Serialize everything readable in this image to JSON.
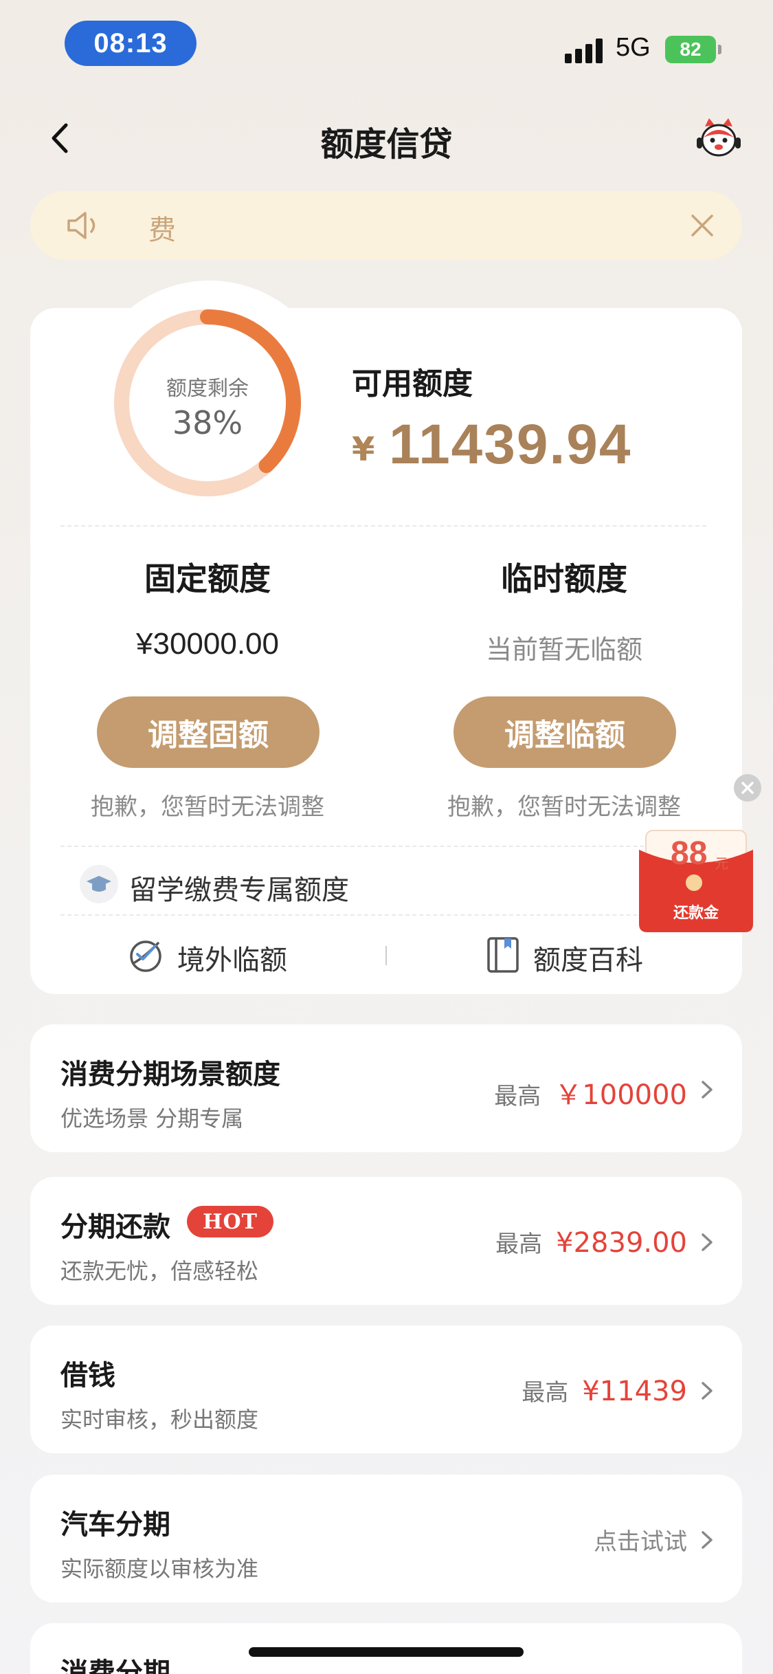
{
  "status_bar": {
    "time": "08:13",
    "network": "5G",
    "battery": "82"
  },
  "nav": {
    "title": "额度信贷"
  },
  "notice": {
    "text": "费"
  },
  "credit": {
    "ring_label": "额度剩余",
    "ring_percent": "38%",
    "ring_fraction": 0.38,
    "available_label": "可用额度",
    "currency": "¥",
    "available_amount": "11439.94"
  },
  "fixed": {
    "title": "固定额度",
    "amount": "¥30000.00",
    "button": "调整固额",
    "note": "抱歉，您暂时无法调整"
  },
  "temporary": {
    "title": "临时额度",
    "status": "当前暂无临额",
    "button": "调整临额",
    "note": "抱歉，您暂时无法调整"
  },
  "study": {
    "label": "留学缴费专属额度"
  },
  "quick_links": [
    {
      "label": "境外临额",
      "icon": "overseas-icon"
    },
    {
      "label": "额度百科",
      "icon": "book-icon"
    }
  ],
  "float_reward": {
    "amount": "88",
    "unit": "元",
    "label": "还款金"
  },
  "features": [
    {
      "title": "消费分期场景额度",
      "subtitle": "优选场景 分期专属",
      "prefix": "最高",
      "amount": "￥100000"
    },
    {
      "title": "分期还款",
      "badge": "HOT",
      "subtitle": "还款无忧，倍感轻松",
      "prefix": "最高",
      "amount": "¥2839.00"
    },
    {
      "title": "借钱",
      "subtitle": "实时审核，秒出额度",
      "prefix": "最高",
      "amount": "¥11439"
    },
    {
      "title": "汽车分期",
      "subtitle": "实际额度以审核为准",
      "action": "点击试试"
    },
    {
      "title": "消费分期"
    }
  ],
  "colors": {
    "accent": "#c49c70",
    "ring": "#ea7b3e",
    "price": "#e4433a"
  }
}
